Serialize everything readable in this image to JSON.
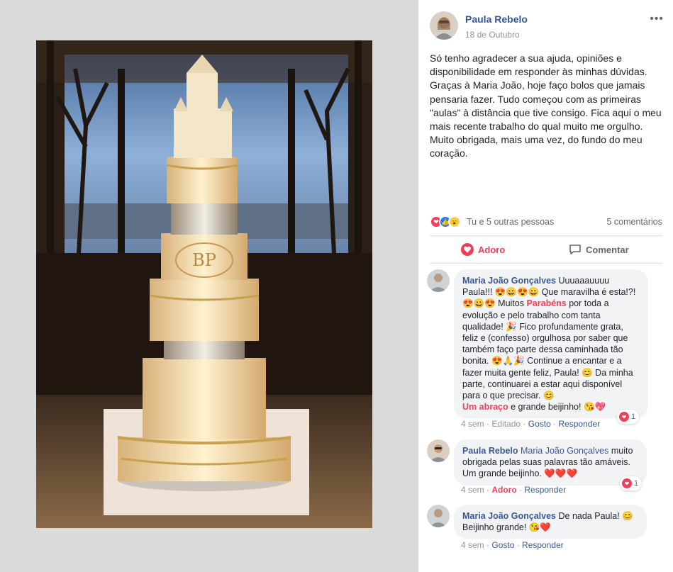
{
  "post": {
    "author": "Paula Rebelo",
    "date": "18 de Outubro",
    "more_label": "•••",
    "text": "Só tenho agradecer a sua ajuda, opiniões e disponibilidade em responder às minhas dúvidas. Graças à Maria João, hoje faço bolos que jamais pensaria fazer. Tudo começou com as primeiras \"aulas\" à distância que tive consigo. Fica aqui o meu mais recente trabalho do qual muito me orgulho. Muito obrigada, mais uma vez, do fundo do meu coração.",
    "photo_monogram": "BP"
  },
  "reactions": {
    "icons": [
      "love-reaction-icon",
      "like-reaction-icon",
      "wow-reaction-icon"
    ],
    "summary": "Tu e 5 outras pessoas",
    "comments_count": "5 comentários"
  },
  "actions": {
    "love_label": "Adoro",
    "comment_label": "Comentar"
  },
  "colors": {
    "link_blue": "#385898",
    "love_red": "#f33e58",
    "like_blue": "#2078f4",
    "bubble_bg": "#f2f3f5"
  },
  "comments": [
    {
      "author": "Maria João Gonçalves",
      "t1": "Uuuaaauuuu Paula!!! 😍😀😍😀 Que maravilha é esta!?! 😍😀😍 Muitos ",
      "highlight": "Parabéns",
      "t2": " por toda a evolução e pelo trabalho com tanta qualidade! 🎉 Fico profundamente grata, feliz e (confesso) orgulhosa por saber que também faço parte dessa caminhada tão bonita. 😍🙏🎉 Continue a encantar e a fazer muita gente feliz, Paula! 😊 Da minha parte, continuarei a estar aqui disponível para o que precisar. 😊",
      "highlight2": "Um abraço",
      "t3": " e grande beijinho! 😘💖",
      "time": "4 sem",
      "edited": "Editado",
      "like": "Gosto",
      "reply": "Responder",
      "reaction_count": "1"
    },
    {
      "author": "Paula Rebelo",
      "mention": "Maria João Gonçalves",
      "text": " muito obrigada pelas suas palavras tão amáveis. Um grande beijinho. ❤️❤️❤️",
      "time": "4 sem",
      "like": "Adoro",
      "reply": "Responder",
      "reaction_count": "1"
    },
    {
      "author": "Maria João Gonçalves",
      "text": "De nada Paula! 😊 Beijinho grande! 😘❤️",
      "time": "4 sem",
      "like": "Gosto",
      "reply": "Responder"
    }
  ]
}
